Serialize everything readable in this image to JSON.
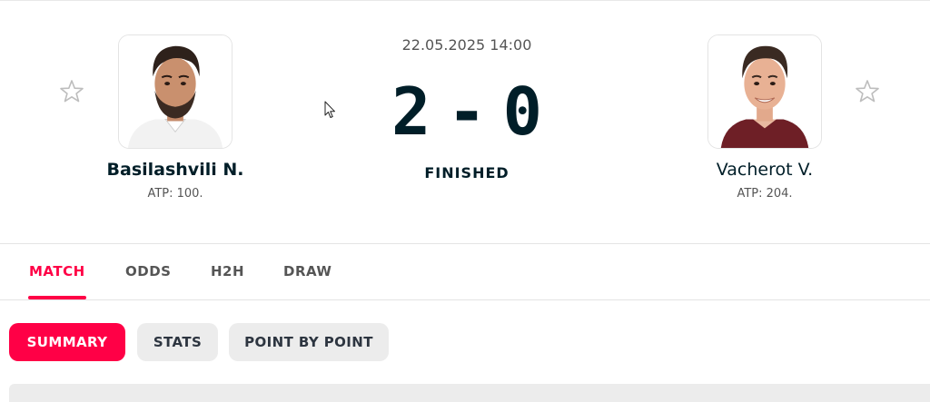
{
  "match": {
    "datetime": "22.05.2025 14:00",
    "score": {
      "home": "2",
      "separator": "-",
      "away": "0"
    },
    "status": "FINISHED"
  },
  "home": {
    "name": "Basilashvili N.",
    "rank": "ATP: 100.",
    "favorite_icon": "star-outline-icon"
  },
  "away": {
    "name": "Vacherot V.",
    "rank": "ATP: 204.",
    "favorite_icon": "star-outline-icon"
  },
  "tabs": [
    {
      "label": "MATCH",
      "active": true
    },
    {
      "label": "ODDS",
      "active": false
    },
    {
      "label": "H2H",
      "active": false
    },
    {
      "label": "DRAW",
      "active": false
    }
  ],
  "subtabs": [
    {
      "label": "SUMMARY",
      "active": true
    },
    {
      "label": "STATS",
      "active": false
    },
    {
      "label": "POINT BY POINT",
      "active": false
    }
  ],
  "colors": {
    "accent": "#ff0046",
    "text": "#001e28",
    "muted": "#555555",
    "pill_bg": "#ececec"
  }
}
